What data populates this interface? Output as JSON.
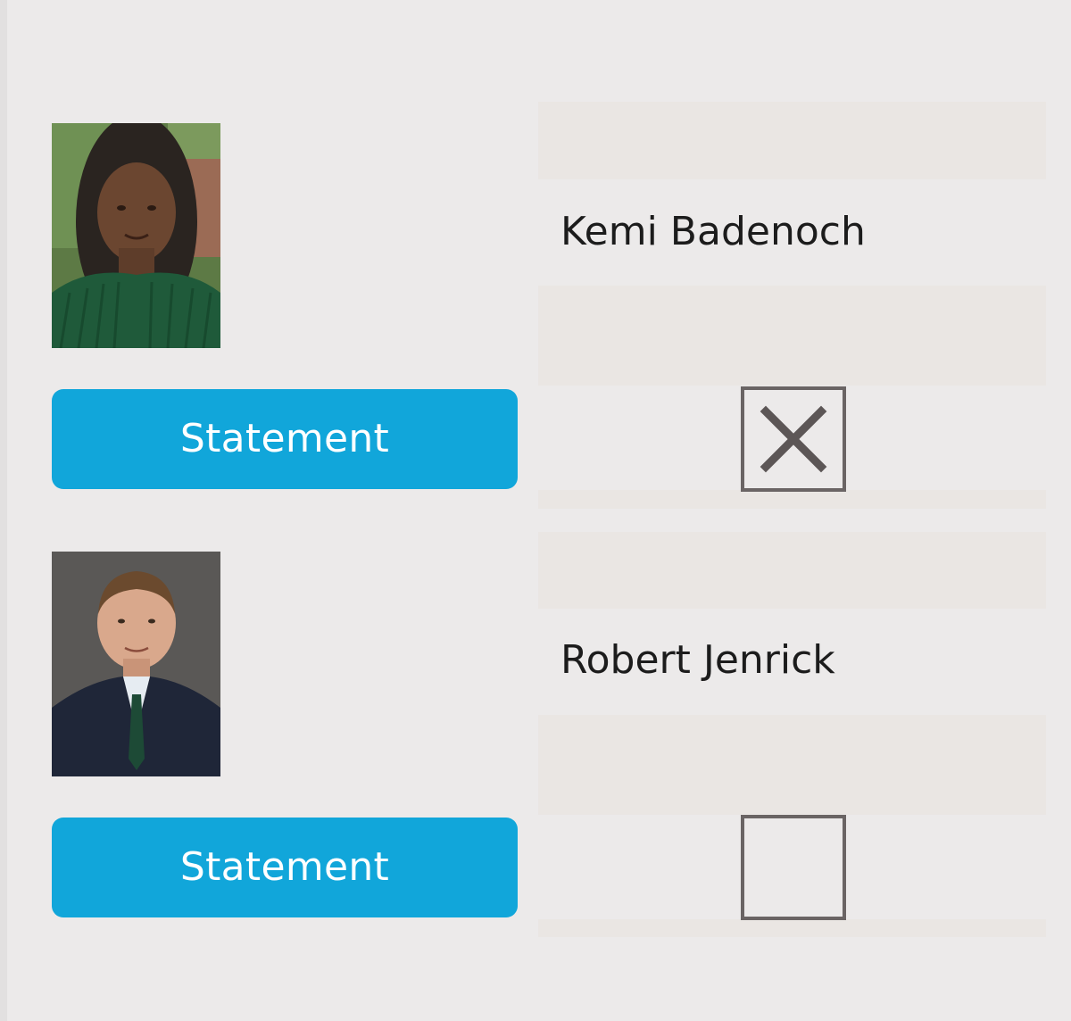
{
  "candidates": [
    {
      "name": "Kemi Badenoch",
      "button_label": "Statement",
      "vote_marked": true,
      "vote_mark": "✕"
    },
    {
      "name": "Robert Jenrick",
      "button_label": "Statement",
      "vote_marked": false,
      "vote_mark": ""
    }
  ],
  "colors": {
    "background": "#eceaea",
    "panel": "#eae6e3",
    "button": "#11a6da",
    "box_border": "#6a6464"
  }
}
